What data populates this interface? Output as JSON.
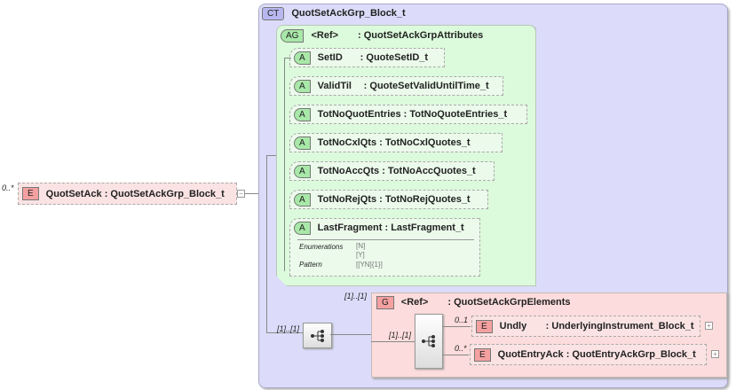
{
  "root": {
    "cardinality": "0..*",
    "badge": "E",
    "name": "QuotSetAck",
    "type": ": QuotSetAckGrp_Block_t"
  },
  "complex_type": {
    "badge": "CT",
    "name": "QuotSetAckGrp_Block_t"
  },
  "attribute_group": {
    "badge": "AG",
    "ref": "<Ref>",
    "name": ": QuotSetAckGrpAttributes",
    "attributes": [
      {
        "badge": "A",
        "name": "SetID",
        "type": ": QuoteSetID_t"
      },
      {
        "badge": "A",
        "name": "ValidTil",
        "type": ": QuoteSetValidUntilTime_t"
      },
      {
        "badge": "A",
        "name": "TotNoQuotEntries",
        "type": ": TotNoQuoteEntries_t"
      },
      {
        "badge": "A",
        "name": "TotNoCxlQts",
        "type": ": TotNoCxlQuotes_t"
      },
      {
        "badge": "A",
        "name": "TotNoAccQts",
        "type": ": TotNoAccQuotes_t"
      },
      {
        "badge": "A",
        "name": "TotNoRejQts",
        "type": ": TotNoRejQuotes_t"
      },
      {
        "badge": "A",
        "name": "LastFragment",
        "type": ": LastFragment_t"
      }
    ],
    "facets": {
      "enum_label": "Enumerations",
      "enums": [
        "[N]",
        "[Y]"
      ],
      "pattern_label": "Pattern",
      "pattern": "[[YN]{1}]"
    }
  },
  "sequence": {
    "cardinality": "[1]..[1]"
  },
  "group": {
    "cardinality": "[1]..[1]",
    "badge": "G",
    "ref": "<Ref>",
    "name": ": QuotSetAckGrpElements",
    "sequence_cardinality": "[1]..[1]",
    "elements": [
      {
        "cardinality": "0..1",
        "badge": "E",
        "name": "Undly",
        "type": ": UnderlyingInstrument_Block_t"
      },
      {
        "cardinality": "0..*",
        "badge": "E",
        "name": "QuotEntryAck",
        "type": ": QuotEntryAckGrp_Block_t"
      }
    ]
  },
  "icons": {
    "expand": "+",
    "collapse": "−"
  }
}
